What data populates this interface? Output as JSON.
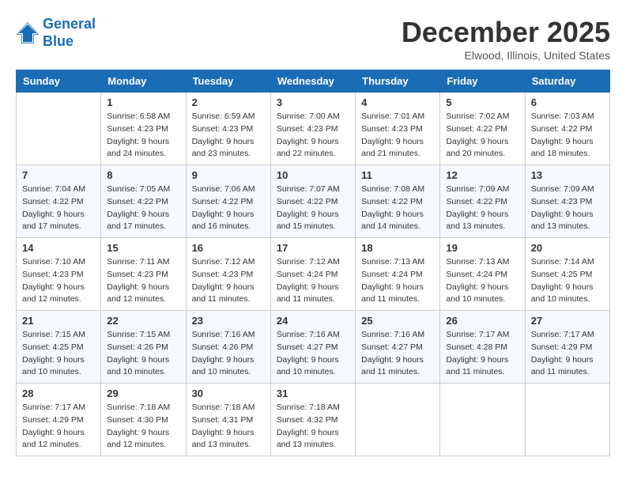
{
  "header": {
    "logo_line1": "General",
    "logo_line2": "Blue",
    "month_title": "December 2025",
    "location": "Elwood, Illinois, United States"
  },
  "days_of_week": [
    "Sunday",
    "Monday",
    "Tuesday",
    "Wednesday",
    "Thursday",
    "Friday",
    "Saturday"
  ],
  "weeks": [
    [
      {
        "day": "",
        "sunrise": "",
        "sunset": "",
        "daylight": ""
      },
      {
        "day": "1",
        "sunrise": "Sunrise: 6:58 AM",
        "sunset": "Sunset: 4:23 PM",
        "daylight": "Daylight: 9 hours and 24 minutes."
      },
      {
        "day": "2",
        "sunrise": "Sunrise: 6:59 AM",
        "sunset": "Sunset: 4:23 PM",
        "daylight": "Daylight: 9 hours and 23 minutes."
      },
      {
        "day": "3",
        "sunrise": "Sunrise: 7:00 AM",
        "sunset": "Sunset: 4:23 PM",
        "daylight": "Daylight: 9 hours and 22 minutes."
      },
      {
        "day": "4",
        "sunrise": "Sunrise: 7:01 AM",
        "sunset": "Sunset: 4:23 PM",
        "daylight": "Daylight: 9 hours and 21 minutes."
      },
      {
        "day": "5",
        "sunrise": "Sunrise: 7:02 AM",
        "sunset": "Sunset: 4:22 PM",
        "daylight": "Daylight: 9 hours and 20 minutes."
      },
      {
        "day": "6",
        "sunrise": "Sunrise: 7:03 AM",
        "sunset": "Sunset: 4:22 PM",
        "daylight": "Daylight: 9 hours and 18 minutes."
      }
    ],
    [
      {
        "day": "7",
        "sunrise": "Sunrise: 7:04 AM",
        "sunset": "Sunset: 4:22 PM",
        "daylight": "Daylight: 9 hours and 17 minutes."
      },
      {
        "day": "8",
        "sunrise": "Sunrise: 7:05 AM",
        "sunset": "Sunset: 4:22 PM",
        "daylight": "Daylight: 9 hours and 17 minutes."
      },
      {
        "day": "9",
        "sunrise": "Sunrise: 7:06 AM",
        "sunset": "Sunset: 4:22 PM",
        "daylight": "Daylight: 9 hours and 16 minutes."
      },
      {
        "day": "10",
        "sunrise": "Sunrise: 7:07 AM",
        "sunset": "Sunset: 4:22 PM",
        "daylight": "Daylight: 9 hours and 15 minutes."
      },
      {
        "day": "11",
        "sunrise": "Sunrise: 7:08 AM",
        "sunset": "Sunset: 4:22 PM",
        "daylight": "Daylight: 9 hours and 14 minutes."
      },
      {
        "day": "12",
        "sunrise": "Sunrise: 7:09 AM",
        "sunset": "Sunset: 4:22 PM",
        "daylight": "Daylight: 9 hours and 13 minutes."
      },
      {
        "day": "13",
        "sunrise": "Sunrise: 7:09 AM",
        "sunset": "Sunset: 4:23 PM",
        "daylight": "Daylight: 9 hours and 13 minutes."
      }
    ],
    [
      {
        "day": "14",
        "sunrise": "Sunrise: 7:10 AM",
        "sunset": "Sunset: 4:23 PM",
        "daylight": "Daylight: 9 hours and 12 minutes."
      },
      {
        "day": "15",
        "sunrise": "Sunrise: 7:11 AM",
        "sunset": "Sunset: 4:23 PM",
        "daylight": "Daylight: 9 hours and 12 minutes."
      },
      {
        "day": "16",
        "sunrise": "Sunrise: 7:12 AM",
        "sunset": "Sunset: 4:23 PM",
        "daylight": "Daylight: 9 hours and 11 minutes."
      },
      {
        "day": "17",
        "sunrise": "Sunrise: 7:12 AM",
        "sunset": "Sunset: 4:24 PM",
        "daylight": "Daylight: 9 hours and 11 minutes."
      },
      {
        "day": "18",
        "sunrise": "Sunrise: 7:13 AM",
        "sunset": "Sunset: 4:24 PM",
        "daylight": "Daylight: 9 hours and 11 minutes."
      },
      {
        "day": "19",
        "sunrise": "Sunrise: 7:13 AM",
        "sunset": "Sunset: 4:24 PM",
        "daylight": "Daylight: 9 hours and 10 minutes."
      },
      {
        "day": "20",
        "sunrise": "Sunrise: 7:14 AM",
        "sunset": "Sunset: 4:25 PM",
        "daylight": "Daylight: 9 hours and 10 minutes."
      }
    ],
    [
      {
        "day": "21",
        "sunrise": "Sunrise: 7:15 AM",
        "sunset": "Sunset: 4:25 PM",
        "daylight": "Daylight: 9 hours and 10 minutes."
      },
      {
        "day": "22",
        "sunrise": "Sunrise: 7:15 AM",
        "sunset": "Sunset: 4:26 PM",
        "daylight": "Daylight: 9 hours and 10 minutes."
      },
      {
        "day": "23",
        "sunrise": "Sunrise: 7:16 AM",
        "sunset": "Sunset: 4:26 PM",
        "daylight": "Daylight: 9 hours and 10 minutes."
      },
      {
        "day": "24",
        "sunrise": "Sunrise: 7:16 AM",
        "sunset": "Sunset: 4:27 PM",
        "daylight": "Daylight: 9 hours and 10 minutes."
      },
      {
        "day": "25",
        "sunrise": "Sunrise: 7:16 AM",
        "sunset": "Sunset: 4:27 PM",
        "daylight": "Daylight: 9 hours and 11 minutes."
      },
      {
        "day": "26",
        "sunrise": "Sunrise: 7:17 AM",
        "sunset": "Sunset: 4:28 PM",
        "daylight": "Daylight: 9 hours and 11 minutes."
      },
      {
        "day": "27",
        "sunrise": "Sunrise: 7:17 AM",
        "sunset": "Sunset: 4:29 PM",
        "daylight": "Daylight: 9 hours and 11 minutes."
      }
    ],
    [
      {
        "day": "28",
        "sunrise": "Sunrise: 7:17 AM",
        "sunset": "Sunset: 4:29 PM",
        "daylight": "Daylight: 9 hours and 12 minutes."
      },
      {
        "day": "29",
        "sunrise": "Sunrise: 7:18 AM",
        "sunset": "Sunset: 4:30 PM",
        "daylight": "Daylight: 9 hours and 12 minutes."
      },
      {
        "day": "30",
        "sunrise": "Sunrise: 7:18 AM",
        "sunset": "Sunset: 4:31 PM",
        "daylight": "Daylight: 9 hours and 13 minutes."
      },
      {
        "day": "31",
        "sunrise": "Sunrise: 7:18 AM",
        "sunset": "Sunset: 4:32 PM",
        "daylight": "Daylight: 9 hours and 13 minutes."
      },
      {
        "day": "",
        "sunrise": "",
        "sunset": "",
        "daylight": ""
      },
      {
        "day": "",
        "sunrise": "",
        "sunset": "",
        "daylight": ""
      },
      {
        "day": "",
        "sunrise": "",
        "sunset": "",
        "daylight": ""
      }
    ]
  ]
}
